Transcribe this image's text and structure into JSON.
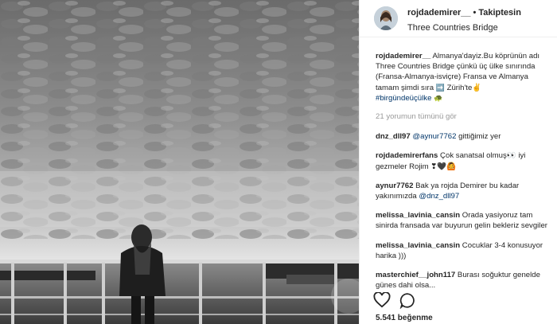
{
  "post": {
    "username": "rojdademirer__",
    "separator": "•",
    "follow_label": "Takiptesin",
    "location": "Three Countries Bridge",
    "caption": {
      "username": "rojdademirer__",
      "text": " Almanya'dayiz.Bu köprünün adı Three Countries Bridge çünkü üç ülke sınırında (Fransa-Almanya-isviçre) Fransa ve Almanya tamam şimdi sıra ",
      "arrow": "➡️",
      "text2": " Zürih'te",
      "hand": "✌",
      "hashtag": "#birgündeüçülke",
      "end_emoji": "🐢"
    },
    "view_all_comments": "21 yorumun tümünü gör",
    "comments": [
      {
        "user": "dnz_dll97",
        "mention": "@aynur7762",
        "text": " gittiğimiz yer"
      },
      {
        "user": "rojdademirerfans",
        "mention": "",
        "text": " Çok sanatsal olmuş👀 iyi gezmeler Rojim ❣🖤🙆"
      },
      {
        "user": "aynur7762",
        "mention": "",
        "text": " Bak ya rojda Demirer bu kadar yakınımızda ",
        "mention2": "@dnz_dll97"
      },
      {
        "user": "melissa_lavinia_cansin",
        "mention": "",
        "text": " Orada yasiyoruz tam sinirda fransada var buyurun gelin bekleriz sevgiler"
      },
      {
        "user": "melissa_lavinia_cansin",
        "mention": "",
        "text": " Cocuklar 3-4 konusuyor harika )))"
      },
      {
        "user": "masterchief__john117",
        "mention": "",
        "text": " Burası soğuktur genelde günes dahi olsa..."
      }
    ],
    "likes": "5.541 beğenme"
  },
  "icons": {
    "like": "heart-icon",
    "comment": "comment-icon"
  },
  "colors": {
    "link": "#003569",
    "muted": "#999999",
    "text": "#262626"
  }
}
